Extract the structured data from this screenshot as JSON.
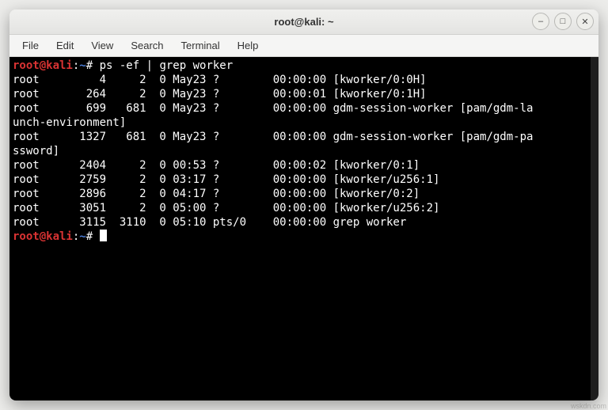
{
  "window": {
    "title": "root@kali: ~"
  },
  "menubar": {
    "items": [
      "File",
      "Edit",
      "View",
      "Search",
      "Terminal",
      "Help"
    ]
  },
  "prompt": {
    "user_host": "root@kali",
    "colon": ":",
    "path": "~",
    "hash": "# "
  },
  "command": "ps -ef | grep worker",
  "output_lines": [
    "root         4     2  0 May23 ?        00:00:00 [kworker/0:0H]",
    "root       264     2  0 May23 ?        00:00:01 [kworker/0:1H]",
    "root       699   681  0 May23 ?        00:00:00 gdm-session-worker [pam/gdm-la",
    "unch-environment]",
    "root      1327   681  0 May23 ?        00:00:00 gdm-session-worker [pam/gdm-pa",
    "ssword]",
    "root      2404     2  0 00:53 ?        00:00:02 [kworker/0:1]",
    "root      2759     2  0 03:17 ?        00:00:00 [kworker/u256:1]",
    "root      2896     2  0 04:17 ?        00:00:00 [kworker/0:2]",
    "root      3051     2  0 05:00 ?        00:00:00 [kworker/u256:2]",
    "root      3115  3110  0 05:10 pts/0    00:00:00 grep worker"
  ],
  "icons": {
    "minimize": "–",
    "maximize": "□",
    "close": "✕"
  },
  "watermark": "wskdn.com"
}
